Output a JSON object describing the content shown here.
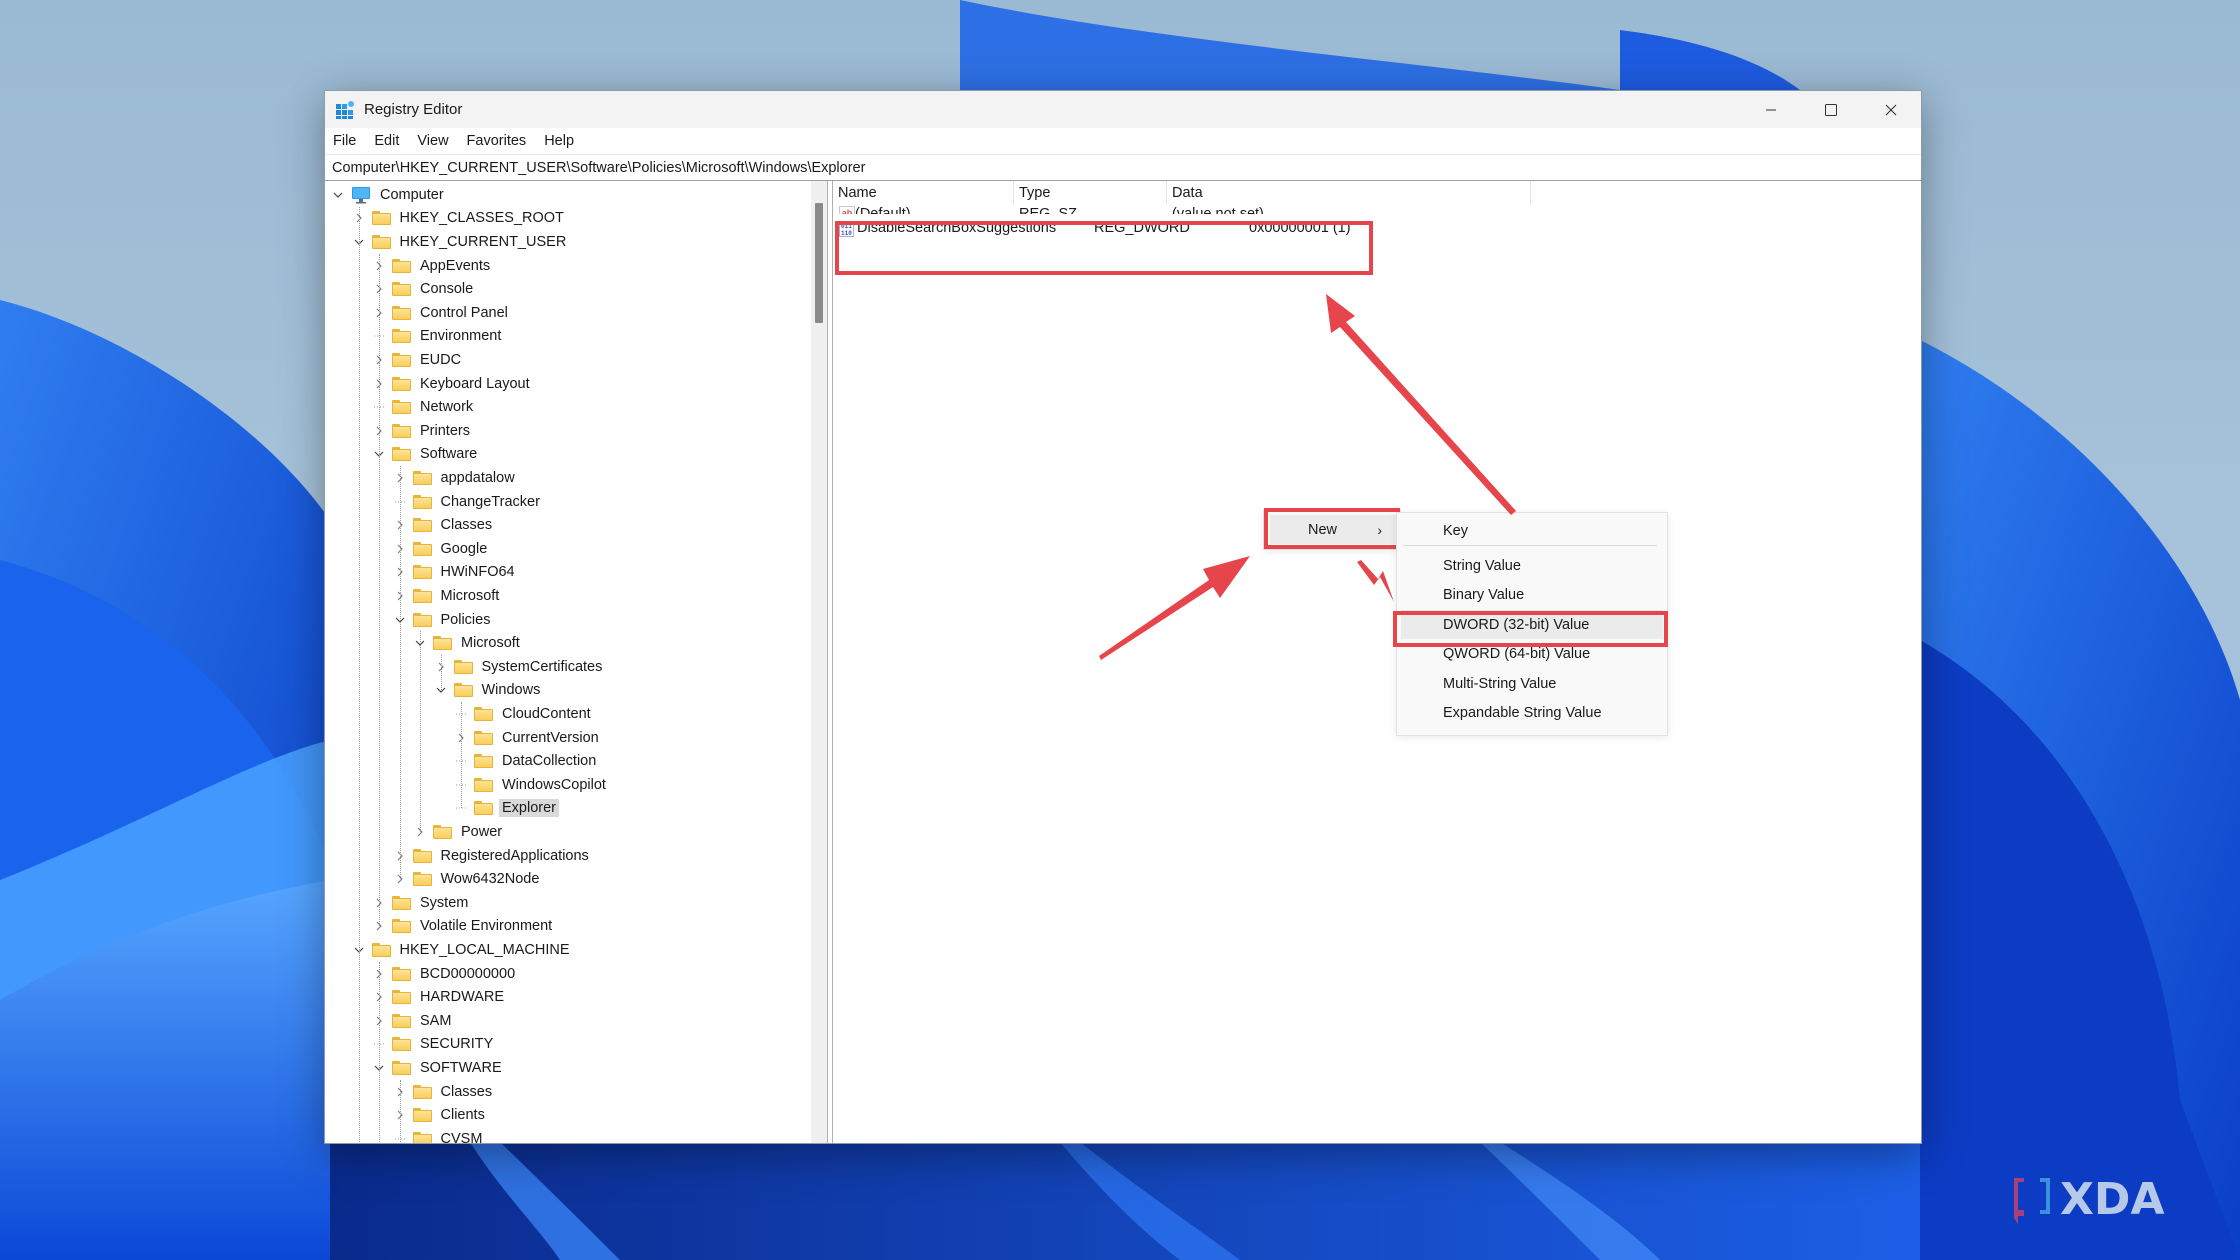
{
  "window": {
    "title": "Registry Editor",
    "controls": {
      "minimize": "minimize-icon",
      "maximize": "maximize-icon",
      "close": "close-icon"
    }
  },
  "menu": [
    "File",
    "Edit",
    "View",
    "Favorites",
    "Help"
  ],
  "address": "Computer\\HKEY_CURRENT_USER\\Software\\Policies\\Microsoft\\Windows\\Explorer",
  "tree": [
    {
      "label": "Computer",
      "level": 0,
      "state": "expanded",
      "icon": "computer-icon"
    },
    {
      "label": "HKEY_CLASSES_ROOT",
      "level": 1,
      "state": "collapsed"
    },
    {
      "label": "HKEY_CURRENT_USER",
      "level": 1,
      "state": "expanded"
    },
    {
      "label": "AppEvents",
      "level": 2,
      "state": "collapsed"
    },
    {
      "label": "Console",
      "level": 2,
      "state": "collapsed"
    },
    {
      "label": "Control Panel",
      "level": 2,
      "state": "collapsed"
    },
    {
      "label": "Environment",
      "level": 2,
      "state": "leaf"
    },
    {
      "label": "EUDC",
      "level": 2,
      "state": "collapsed"
    },
    {
      "label": "Keyboard Layout",
      "level": 2,
      "state": "collapsed"
    },
    {
      "label": "Network",
      "level": 2,
      "state": "leaf"
    },
    {
      "label": "Printers",
      "level": 2,
      "state": "collapsed"
    },
    {
      "label": "Software",
      "level": 2,
      "state": "expanded"
    },
    {
      "label": "appdatalow",
      "level": 3,
      "state": "collapsed"
    },
    {
      "label": "ChangeTracker",
      "level": 3,
      "state": "leaf"
    },
    {
      "label": "Classes",
      "level": 3,
      "state": "collapsed"
    },
    {
      "label": "Google",
      "level": 3,
      "state": "collapsed"
    },
    {
      "label": "HWiNFO64",
      "level": 3,
      "state": "collapsed"
    },
    {
      "label": "Microsoft",
      "level": 3,
      "state": "collapsed"
    },
    {
      "label": "Policies",
      "level": 3,
      "state": "expanded"
    },
    {
      "label": "Microsoft",
      "level": 4,
      "state": "expanded"
    },
    {
      "label": "SystemCertificates",
      "level": 5,
      "state": "collapsed"
    },
    {
      "label": "Windows",
      "level": 5,
      "state": "expanded"
    },
    {
      "label": "CloudContent",
      "level": 6,
      "state": "leaf"
    },
    {
      "label": "CurrentVersion",
      "level": 6,
      "state": "collapsed"
    },
    {
      "label": "DataCollection",
      "level": 6,
      "state": "leaf"
    },
    {
      "label": "WindowsCopilot",
      "level": 6,
      "state": "leaf"
    },
    {
      "label": "Explorer",
      "level": 6,
      "state": "leaf",
      "selected": true
    },
    {
      "label": "Power",
      "level": 4,
      "state": "collapsed"
    },
    {
      "label": "RegisteredApplications",
      "level": 3,
      "state": "collapsed"
    },
    {
      "label": "Wow6432Node",
      "level": 3,
      "state": "collapsed"
    },
    {
      "label": "System",
      "level": 2,
      "state": "collapsed"
    },
    {
      "label": "Volatile Environment",
      "level": 2,
      "state": "collapsed"
    },
    {
      "label": "HKEY_LOCAL_MACHINE",
      "level": 1,
      "state": "expanded"
    },
    {
      "label": "BCD00000000",
      "level": 2,
      "state": "collapsed"
    },
    {
      "label": "HARDWARE",
      "level": 2,
      "state": "collapsed"
    },
    {
      "label": "SAM",
      "level": 2,
      "state": "collapsed"
    },
    {
      "label": "SECURITY",
      "level": 2,
      "state": "leaf"
    },
    {
      "label": "SOFTWARE",
      "level": 2,
      "state": "expanded"
    },
    {
      "label": "Classes",
      "level": 3,
      "state": "collapsed"
    },
    {
      "label": "Clients",
      "level": 3,
      "state": "collapsed"
    },
    {
      "label": "CVSM",
      "level": 3,
      "state": "leaf"
    }
  ],
  "list": {
    "columns": [
      "Name",
      "Type",
      "Data"
    ],
    "rows": [
      {
        "name": "(Default)",
        "type": "REG_SZ",
        "data": "(value not set)",
        "icon": "string-value-icon",
        "obscured": true
      },
      {
        "name": "DisableSearchBoxSuggestions",
        "type": "REG_DWORD",
        "data": "0x00000001 (1)",
        "icon": "binary-value-icon",
        "highlighted": true
      }
    ]
  },
  "context_menu": {
    "parent_item": "New",
    "submenu": [
      {
        "label": "Key"
      },
      {
        "separator": true
      },
      {
        "label": "String Value"
      },
      {
        "label": "Binary Value"
      },
      {
        "label": "DWORD (32-bit) Value",
        "hovered": true,
        "highlighted": true
      },
      {
        "label": "QWORD (64-bit) Value"
      },
      {
        "label": "Multi-String Value"
      },
      {
        "label": "Expandable String Value"
      }
    ]
  },
  "annotation_color": "#e5454b",
  "watermark": "XDA"
}
